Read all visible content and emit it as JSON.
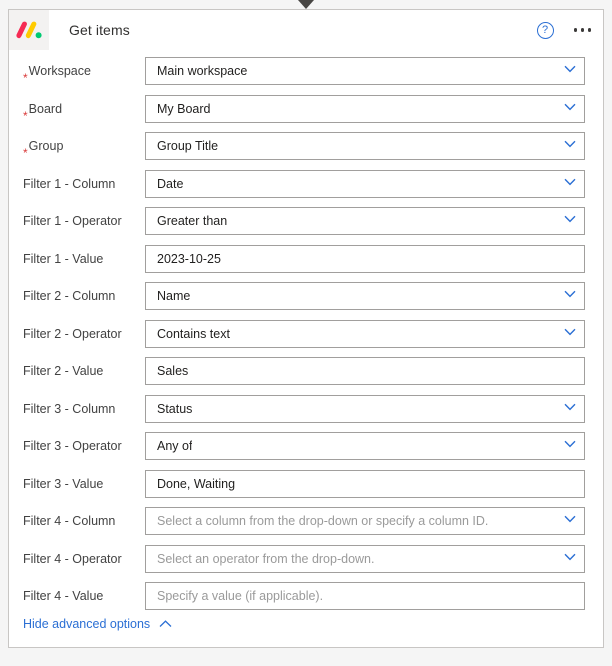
{
  "header": {
    "title": "Get items",
    "logo_icon": "monday-logo-icon",
    "help_icon": "help-question-icon",
    "help_glyph": "?",
    "more_icon": "more-options-icon"
  },
  "connector": {
    "icon": "flow-arrow-down-icon"
  },
  "colors": {
    "accent_blue": "#2b6fd4",
    "required_red": "#d93a3a",
    "border_gray": "#a19f9d",
    "card_border": "#c8c6c4",
    "page_bg": "#f5f5f5",
    "logo_red": "#f62b54",
    "logo_yellow": "#ffcb00",
    "logo_green": "#00ca72"
  },
  "fields": [
    {
      "label": "Workspace",
      "required": true,
      "value": "Main workspace",
      "placeholder": "",
      "dropdown": true
    },
    {
      "label": "Board",
      "required": true,
      "value": "My Board",
      "placeholder": "",
      "dropdown": true
    },
    {
      "label": "Group",
      "required": true,
      "value": "Group Title",
      "placeholder": "",
      "dropdown": true
    },
    {
      "label": "Filter 1 - Column",
      "required": false,
      "value": "Date",
      "placeholder": "",
      "dropdown": true
    },
    {
      "label": "Filter 1 - Operator",
      "required": false,
      "value": "Greater than",
      "placeholder": "",
      "dropdown": true
    },
    {
      "label": "Filter 1 - Value",
      "required": false,
      "value": "2023-10-25",
      "placeholder": "",
      "dropdown": false
    },
    {
      "label": "Filter 2 - Column",
      "required": false,
      "value": "Name",
      "placeholder": "",
      "dropdown": true
    },
    {
      "label": "Filter 2 - Operator",
      "required": false,
      "value": "Contains text",
      "placeholder": "",
      "dropdown": true
    },
    {
      "label": "Filter 2 - Value",
      "required": false,
      "value": "Sales",
      "placeholder": "",
      "dropdown": false
    },
    {
      "label": "Filter 3 - Column",
      "required": false,
      "value": "Status",
      "placeholder": "",
      "dropdown": true
    },
    {
      "label": "Filter 3 - Operator",
      "required": false,
      "value": "Any of",
      "placeholder": "",
      "dropdown": true
    },
    {
      "label": "Filter 3 - Value",
      "required": false,
      "value": "Done, Waiting",
      "placeholder": "",
      "dropdown": false
    },
    {
      "label": "Filter 4 - Column",
      "required": false,
      "value": "",
      "placeholder": "Select a column from the drop-down or specify a column ID.",
      "dropdown": true
    },
    {
      "label": "Filter 4 - Operator",
      "required": false,
      "value": "",
      "placeholder": "Select an operator from the drop-down.",
      "dropdown": true
    },
    {
      "label": "Filter 4 - Value",
      "required": false,
      "value": "",
      "placeholder": "Specify a value (if applicable).",
      "dropdown": false
    }
  ],
  "footer": {
    "link_label": "Hide advanced options",
    "chevron_icon": "chevron-up-icon"
  }
}
